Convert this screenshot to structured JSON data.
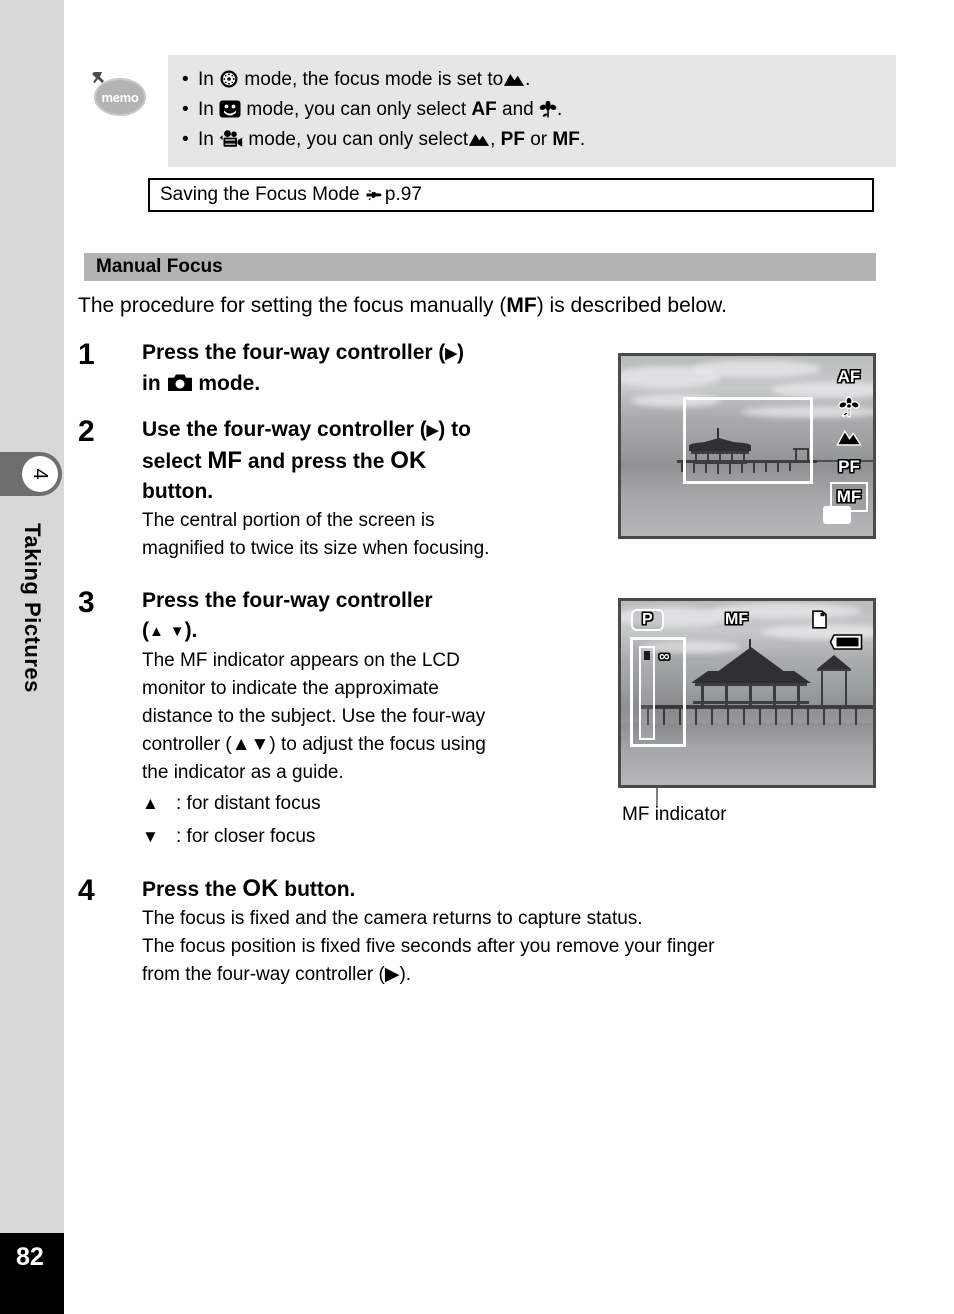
{
  "sidebar": {
    "chapter_number": "4",
    "chapter_title": "Taking Pictures",
    "page_number": "82"
  },
  "memo": {
    "badge_label": "memo",
    "bullets": [
      {
        "bullet": "•",
        "pre": "In",
        "mode_icon": "fireworks-icon",
        "mid": "mode, the focus mode is set to",
        "end_icon": "mountain-infinity-icon",
        "post": "."
      },
      {
        "bullet": "•",
        "pre": "In",
        "mode_icon": "smiley-half-length-icon",
        "mid": "mode, you can only select",
        "token1": "AF",
        "conj": "and",
        "end_icon": "macro-flower-icon",
        "post": "."
      },
      {
        "bullet": "•",
        "pre": "In",
        "mode_icon": "movie-camera-icon",
        "mid": "mode, you can only select",
        "end_icon": "mountain-infinity-icon",
        "comma": ",",
        "token1": "PF",
        "conj": "or",
        "token2": "MF",
        "post": "."
      }
    ]
  },
  "reference_box": {
    "text": "Saving the Focus Mode",
    "pointer_icon": "pointing-hand-icon",
    "page_ref": "p.97"
  },
  "section": {
    "header": "Manual Focus",
    "intro_pre": "The procedure for setting the focus manually (",
    "intro_token": "MF",
    "intro_post": ") is described below."
  },
  "steps": [
    {
      "number": "1",
      "title_line1_pre": "Press the four-way controller (",
      "title_line1_arrow": "▶",
      "title_line1_post": ")",
      "title_line2_pre": "in",
      "title_line2_icon": "camera-mode-icon",
      "title_line2_post": "mode.",
      "desc": []
    },
    {
      "number": "2",
      "title_line1_pre": "Use the four-way controller (",
      "title_line1_arrow": "▶",
      "title_line1_post": ") to",
      "title_line2_pre": "select",
      "title_line2_token": "MF",
      "title_line2_mid": "and press the",
      "title_line2_token2": "OK",
      "title_line3": "button.",
      "desc": [
        "The central portion of the screen is",
        "magnified to twice its size when focusing."
      ]
    },
    {
      "number": "3",
      "title_line1": "Press the four-way controller",
      "title_line2_pre": "(",
      "title_line2_up": "▲",
      "title_line2_down": "▼",
      "title_line2_post": ").",
      "desc": [
        "The MF indicator appears on the LCD",
        "monitor to indicate the approximate",
        "distance to the subject. Use the four-way",
        "controller (▲▼) to adjust the focus using",
        "the indicator as a guide."
      ],
      "arrow_notes": [
        {
          "glyph": "▲",
          "text": ":  for distant focus"
        },
        {
          "glyph": "▼",
          "text": ":  for closer focus"
        }
      ]
    },
    {
      "number": "4",
      "title_pre": "Press the",
      "title_token": "OK",
      "title_post": "button.",
      "desc": [
        "The focus is fixed and the camera returns to capture status.",
        "The focus position is fixed five seconds after you remove your finger",
        "from the four-way controller (▶)."
      ]
    }
  ],
  "figures": {
    "lcd1": {
      "name": "focus-mode-selection-screen",
      "focus_menu": [
        {
          "label": "AF",
          "type": "text",
          "selected": false
        },
        {
          "label": "macro-flower-icon",
          "type": "icon",
          "selected": false
        },
        {
          "label": "mountain-infinity-icon",
          "type": "icon",
          "selected": false
        },
        {
          "label": "PF",
          "type": "text",
          "selected": false
        },
        {
          "label": "MF",
          "type": "text",
          "selected": true
        }
      ]
    },
    "lcd2": {
      "name": "mf-indicator-screen",
      "mode_badge": "P",
      "focus_label": "MF",
      "card_icon": "memory-card-icon",
      "battery_icon": "battery-full-icon",
      "infinity_symbol": "∞",
      "caption": "MF indicator"
    }
  },
  "colors": {
    "sidebar_gray": "#d8d8d8",
    "tab_gray": "#6e6e6e",
    "header_gray": "#b3b3b3",
    "memo_box_gray": "#e6e6e6",
    "page_block_black": "#000000"
  }
}
